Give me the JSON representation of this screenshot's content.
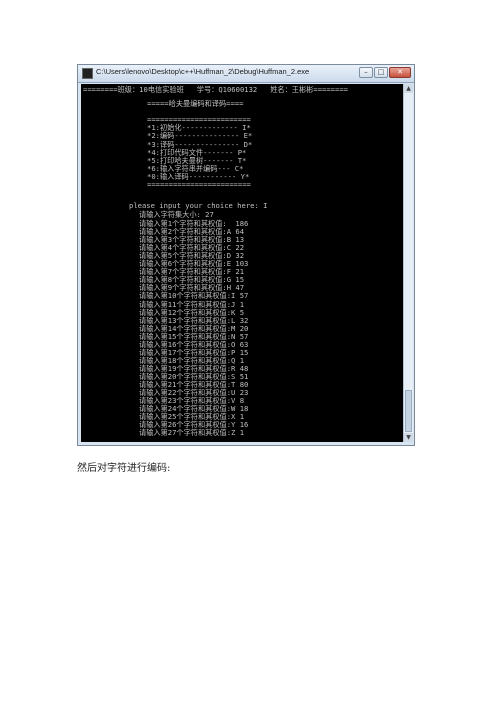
{
  "window": {
    "title": "C:\\Users\\lenovo\\Desktop\\c++\\Huffman_2\\Debug\\Huffman_2.exe",
    "controls": {
      "minimize": "–",
      "maximize": "□",
      "close": "✕"
    }
  },
  "console": {
    "header": "========班级：10电信实验班   学号：Q10600132   姓名：王彬彬========",
    "menu": [
      "=====哈夫曼编码和译码====",
      "",
      "========================",
      "*1:初始化------------- I*",
      "*2:编码--------------- E*",
      "*3:译码--------------- D*",
      "*4:打印代码文件------- P*",
      "*5:打印哈夫曼树------- T*",
      "*6:输入字符串并编码--- C*",
      "*0:输入译码----------- Y*",
      "========================"
    ],
    "prompt": "please input your choice here: I",
    "size_prompt": "请输入字符集大小: 27",
    "entries": [
      "请输入第1个字符和其权值:  186",
      "请输入第2个字符和其权值:A 64",
      "请输入第3个字符和其权值:B 13",
      "请输入第4个字符和其权值:C 22",
      "请输入第5个字符和其权值:D 32",
      "请输入第6个字符和其权值:E 103",
      "请输入第7个字符和其权值:F 21",
      "请输入第8个字符和其权值:G 15",
      "请输入第9个字符和其权值:H 47",
      "请输入第10个字符和其权值:I 57",
      "请输入第11个字符和其权值:J 1",
      "请输入第12个字符和其权值:K 5",
      "请输入第13个字符和其权值:L 32",
      "请输入第14个字符和其权值:M 20",
      "请输入第15个字符和其权值:N 57",
      "请输入第16个字符和其权值:O 63",
      "请输入第17个字符和其权值:P 15",
      "请输入第18个字符和其权值:Q 1",
      "请输入第19个字符和其权值:R 48",
      "请输入第20个字符和其权值:S 51",
      "请输入第21个字符和其权值:T 80",
      "请输入第22个字符和其权值:U 23",
      "请输入第23个字符和其权值:V 8",
      "请输入第24个字符和其权值:W 18",
      "请输入第25个字符和其权值:X 1",
      "请输入第26个字符和其权值:Y 16",
      "请输入第27个字符和其权值:Z 1"
    ]
  },
  "caption": "然后对字符进行编码:"
}
